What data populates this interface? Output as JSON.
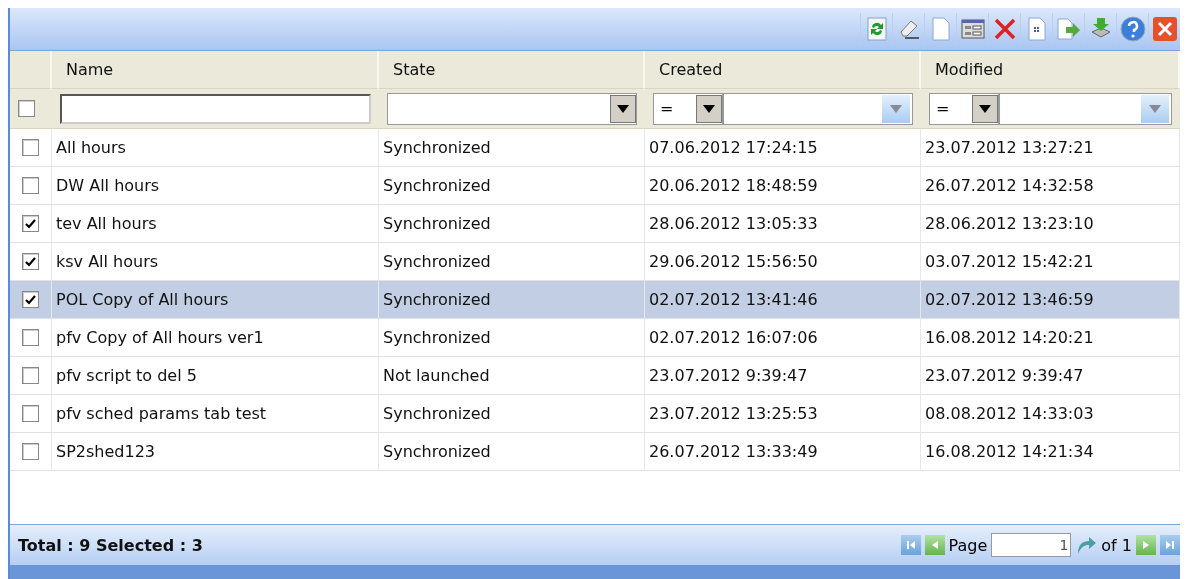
{
  "columns": [
    "Name",
    "State",
    "Created",
    "Modified"
  ],
  "filters": {
    "select_all_checked": false,
    "created_operator": "=",
    "modified_operator": "="
  },
  "rows": [
    {
      "name": "All hours",
      "state": "Synchronized",
      "created": "07.06.2012 17:24:15",
      "modified": "23.07.2012 13:27:21",
      "checked": false,
      "selected": false
    },
    {
      "name": "DW All hours",
      "state": "Synchronized",
      "created": "20.06.2012 18:48:59",
      "modified": "26.07.2012 14:32:58",
      "checked": false,
      "selected": false
    },
    {
      "name": "tev All hours",
      "state": "Synchronized",
      "created": "28.06.2012 13:05:33",
      "modified": "28.06.2012 13:23:10",
      "checked": true,
      "selected": false
    },
    {
      "name": "ksv All hours",
      "state": "Synchronized",
      "created": "29.06.2012 15:56:50",
      "modified": "03.07.2012 15:42:21",
      "checked": true,
      "selected": false
    },
    {
      "name": "POL Copy of All hours",
      "state": "Synchronized",
      "created": "02.07.2012 13:41:46",
      "modified": "02.07.2012 13:46:59",
      "checked": true,
      "selected": true
    },
    {
      "name": "pfv Copy of All hours ver1",
      "state": "Synchronized",
      "created": "02.07.2012 16:07:06",
      "modified": "16.08.2012 14:20:21",
      "checked": false,
      "selected": false
    },
    {
      "name": "pfv script to del 5",
      "state": "Not launched",
      "created": "23.07.2012 9:39:47",
      "modified": "23.07.2012 9:39:47",
      "checked": false,
      "selected": false
    },
    {
      "name": "pfv sched params tab test",
      "state": "Synchronized",
      "created": "23.07.2012 13:25:53",
      "modified": "08.08.2012 14:33:03",
      "checked": false,
      "selected": false
    },
    {
      "name": "SP2shed123",
      "state": "Synchronized",
      "created": "26.07.2012 13:33:49",
      "modified": "16.08.2012 14:21:34",
      "checked": false,
      "selected": false
    }
  ],
  "footer": {
    "summary": "Total : 9 Selected : 3",
    "page_label": "Page",
    "page_value": "1",
    "page_total": "of 1"
  }
}
